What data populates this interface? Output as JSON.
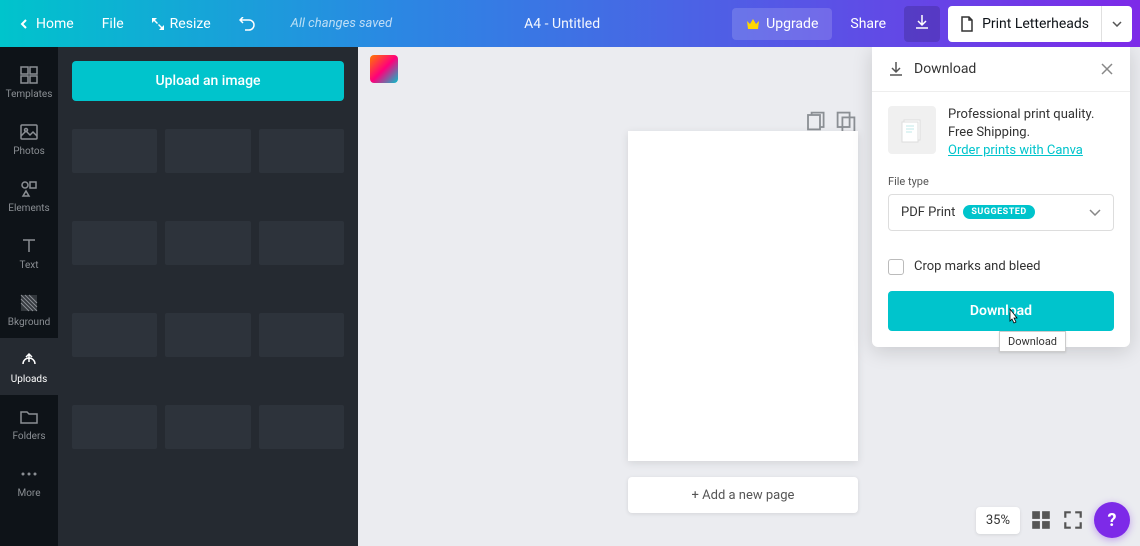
{
  "header": {
    "home": "Home",
    "file": "File",
    "resize": "Resize",
    "status": "All changes saved",
    "doc_title": "A4 - Untitled",
    "upgrade": "Upgrade",
    "share": "Share",
    "print_option": "Print Letterheads"
  },
  "sidebar": {
    "templates": "Templates",
    "photos": "Photos",
    "elements": "Elements",
    "text": "Text",
    "bkground": "Bkground",
    "uploads": "Uploads",
    "folders": "Folders",
    "more": "More"
  },
  "panel": {
    "upload_button": "Upload an image"
  },
  "canvas": {
    "add_page": "+ Add a new page"
  },
  "download": {
    "title": "Download",
    "promo_text": "Professional print quality. Free Shipping.",
    "promo_link": "Order prints with Canva",
    "file_type_label": "File type",
    "file_type_value": "PDF Print",
    "file_type_badge": "SUGGESTED",
    "crop_label": "Crop marks and bleed",
    "button": "Download",
    "tooltip": "Download"
  },
  "footer": {
    "zoom": "35%",
    "help": "?"
  }
}
